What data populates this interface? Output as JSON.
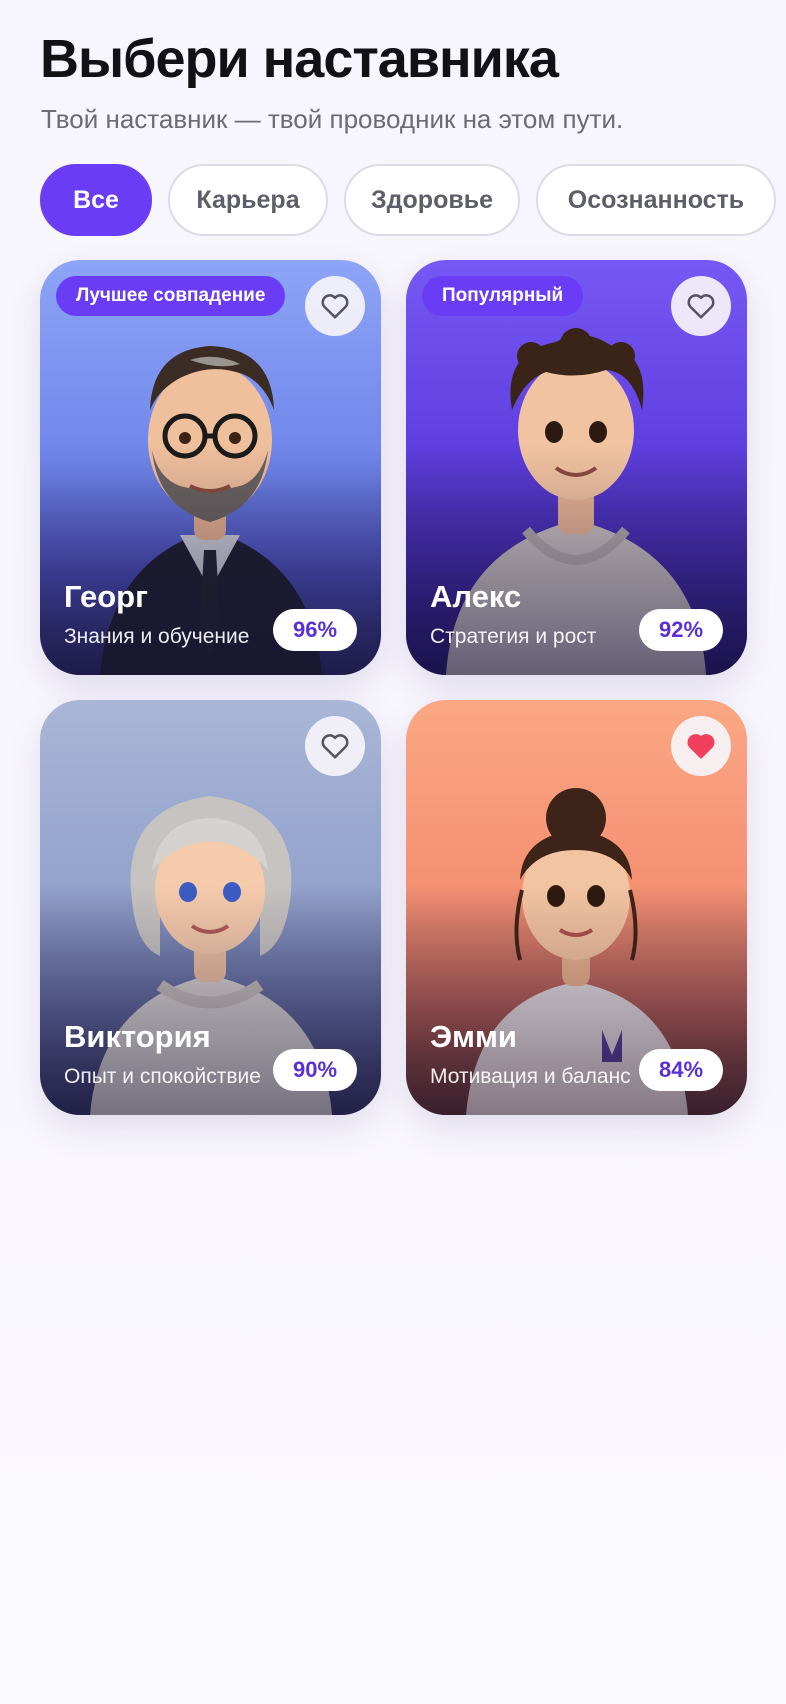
{
  "header": {
    "title": "Выбери наставника",
    "subtitle": "Твой наставник — твой проводник на этом пути."
  },
  "filters": [
    {
      "label": "Все",
      "active": true
    },
    {
      "label": "Карьера",
      "active": false
    },
    {
      "label": "Здоровье",
      "active": false
    },
    {
      "label": "Осознанность",
      "active": false
    }
  ],
  "mentors": [
    {
      "name": "Георг",
      "role": "Знания и обучение",
      "match": "96%",
      "badge": "Лучшее совпадение",
      "favorite": false,
      "icon": "heart-outline-icon"
    },
    {
      "name": "Алекс",
      "role": "Стратегия и рост",
      "match": "92%",
      "badge": "Популярный",
      "favorite": false,
      "icon": "heart-outline-icon"
    },
    {
      "name": "Виктория",
      "role": "Опыт и спокойствие",
      "match": "90%",
      "favorite": false,
      "icon": "heart-outline-icon"
    },
    {
      "name": "Эмми",
      "role": "Мотивация и баланс",
      "match": "84%",
      "favorite": true,
      "icon": "heart-filled-icon"
    }
  ],
  "colors": {
    "accent": "#6a3cf6",
    "favorite": "#f0405e",
    "match_text": "#5a2fd6"
  }
}
